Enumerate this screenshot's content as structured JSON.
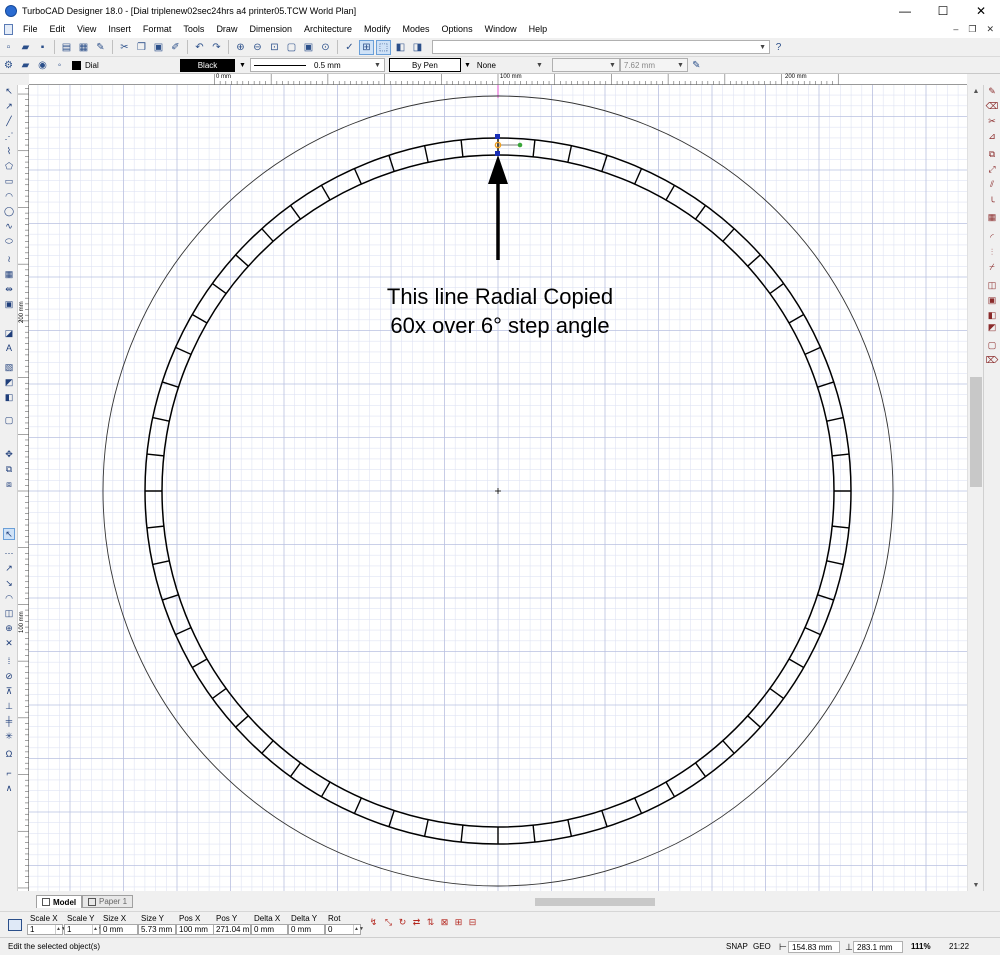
{
  "window": {
    "title": "TurboCAD Designer 18.0 - [Dial triplenew02sec24hrs a4 printer05.TCW World Plan]",
    "minimize": "—",
    "maximize": "☐",
    "close": "✕"
  },
  "menu": {
    "items": [
      "File",
      "Edit",
      "View",
      "Insert",
      "Format",
      "Tools",
      "Draw",
      "Dimension",
      "Architecture",
      "Modify",
      "Modes",
      "Options",
      "Window",
      "Help"
    ],
    "mdi_min": "–",
    "mdi_restore": "❐",
    "mdi_close": "✕"
  },
  "property_bar": {
    "layer": "Dial",
    "pen_color": "Black",
    "line_width": "0.5 mm",
    "by_pen": "By Pen",
    "fill": "None",
    "thickness": "7.62 mm"
  },
  "rulers": {
    "top_labels": [
      "0 mm",
      "100 mm",
      "200 mm"
    ],
    "left_labels": [
      "200 mm",
      "100 mm"
    ]
  },
  "drawing": {
    "annotation_line1": "This line Radial Copied",
    "annotation_line2": "60x over 6° step angle",
    "tick_count": 60,
    "step_angle_deg": 6
  },
  "tabs": {
    "model": "Model",
    "paper": "Paper 1"
  },
  "inspector": {
    "fields": [
      {
        "label": "Scale X",
        "value": "1"
      },
      {
        "label": "Scale Y",
        "value": "1"
      },
      {
        "label": "Size X",
        "value": "0 mm"
      },
      {
        "label": "Size Y",
        "value": "5.73 mm"
      },
      {
        "label": "Pos X",
        "value": "100 mm"
      },
      {
        "label": "Pos Y",
        "value": "271.04 m"
      },
      {
        "label": "Delta X",
        "value": "0 mm"
      },
      {
        "label": "Delta Y",
        "value": "0 mm"
      },
      {
        "label": "Rot",
        "value": "0"
      }
    ]
  },
  "status": {
    "message": "Edit the selected object(s)",
    "snap": "SNAP",
    "geo": "GEO",
    "x_coord": "154.83 mm",
    "y_coord": "283.1 mm",
    "zoom": "111%",
    "time": "21:22"
  },
  "colors": {
    "grid_minor": "#dfe3f3",
    "grid_major": "#b9c0e0",
    "selection_handle": "#1a2fb8",
    "snap_point": "#f0a020",
    "rotate_handle": "#3aa63a",
    "guide_line": "#e04fd0"
  }
}
